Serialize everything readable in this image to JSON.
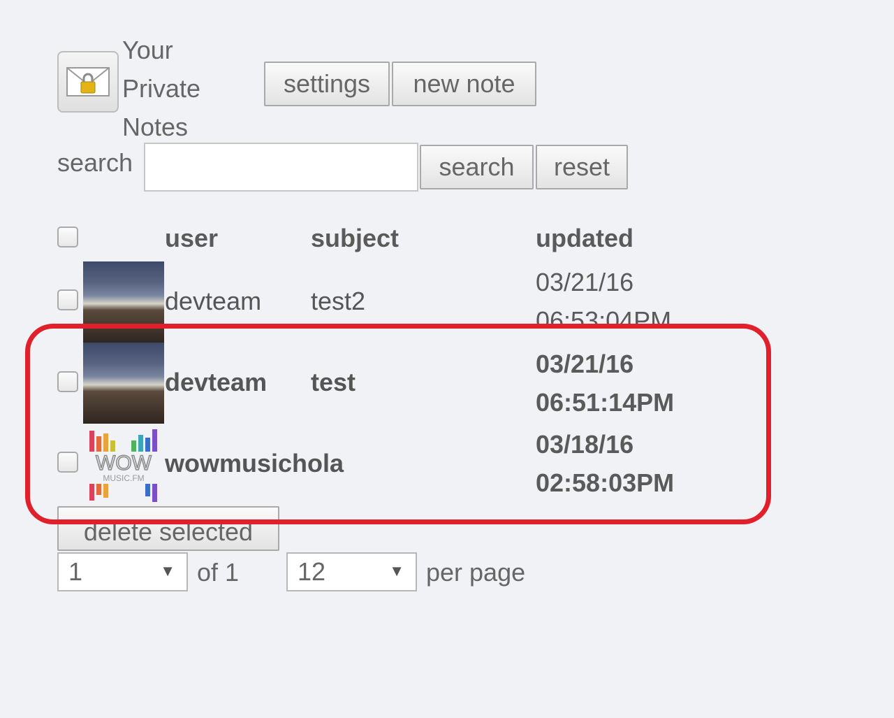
{
  "header": {
    "app_title_lines": [
      "Your",
      "Private",
      "Notes"
    ],
    "settings_label": "settings",
    "new_note_label": "new note"
  },
  "search": {
    "label": "search",
    "value": "",
    "button_label": "search",
    "reset_label": "reset"
  },
  "table": {
    "columns": {
      "user": "user",
      "subject": "subject",
      "updated": "updated"
    },
    "rows": [
      {
        "user": "devteam",
        "subject": "test2",
        "date": "03/21/16",
        "time": "06:53:04PM",
        "unread": false,
        "avatar": "landscape-avatar"
      },
      {
        "user": "devteam",
        "subject": "test",
        "date": "03/21/16",
        "time": "06:51:14PM",
        "unread": true,
        "avatar": "landscape-avatar"
      },
      {
        "user": "wowmusichola",
        "subject": "",
        "date": "03/18/16",
        "time": "02:58:03PM",
        "unread": true,
        "avatar": "wow-music-logo"
      }
    ]
  },
  "actions": {
    "delete_label": "delete selected"
  },
  "pagination": {
    "page_value": "1",
    "of_text": "of 1",
    "per_page_value": "12",
    "per_page_text": "per page"
  },
  "colors": {
    "highlight": "#e0202a",
    "background": "#f1f2f5"
  }
}
